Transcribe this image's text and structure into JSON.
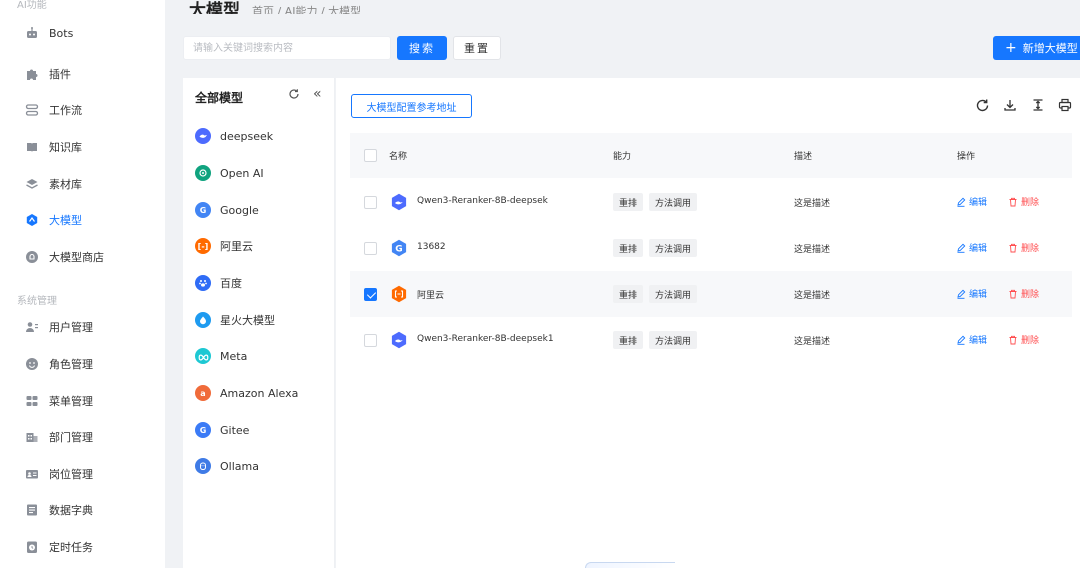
{
  "sidebar": {
    "group_ai": "AI功能",
    "group_system": "系统管理",
    "items": [
      {
        "label": "Bots",
        "icon": "robot-icon"
      },
      {
        "label": "插件",
        "icon": "puzzle-icon"
      },
      {
        "label": "工作流",
        "icon": "workflow-icon"
      },
      {
        "label": "知识库",
        "icon": "book-icon"
      },
      {
        "label": "素材库",
        "icon": "layers-icon"
      },
      {
        "label": "大模型",
        "icon": "model-icon",
        "active": true
      },
      {
        "label": "大模型商店",
        "icon": "store-icon"
      }
    ],
    "system_items": [
      {
        "label": "用户管理",
        "icon": "user-icon"
      },
      {
        "label": "角色管理",
        "icon": "role-icon"
      },
      {
        "label": "菜单管理",
        "icon": "menu-grid-icon"
      },
      {
        "label": "部门管理",
        "icon": "department-icon"
      },
      {
        "label": "岗位管理",
        "icon": "id-card-icon"
      },
      {
        "label": "数据字典",
        "icon": "dictionary-icon"
      },
      {
        "label": "定时任务",
        "icon": "clock-icon"
      }
    ]
  },
  "header": {
    "title": "大模型",
    "breadcrumb": "首页 / AI能力 / 大模型"
  },
  "toolbar": {
    "search_placeholder": "请输入关键词搜索内容",
    "search_label": "搜索",
    "reset_label": "重置",
    "add_label": "新增大模型"
  },
  "model_panel": {
    "title": "全部模型",
    "models": [
      {
        "label": "deepseek",
        "color": "#4d6bfe"
      },
      {
        "label": "Open AI",
        "color": "#10a37f"
      },
      {
        "label": "Google",
        "color": "#4285f4"
      },
      {
        "label": "阿里云",
        "color": "#ff6a00"
      },
      {
        "label": "百度",
        "color": "#2f6cf6"
      },
      {
        "label": "星火大模型",
        "color": "#1e9bf0"
      },
      {
        "label": "Meta",
        "color": "#1ec8d3"
      },
      {
        "label": "Amazon Alexa",
        "color": "#f06b3a"
      },
      {
        "label": "Gitee",
        "color": "#3b7bf6"
      },
      {
        "label": "Ollama",
        "color": "#3f7be6"
      }
    ]
  },
  "main": {
    "ref_button": "大模型配置参考地址",
    "columns": {
      "name": "名称",
      "ability": "能力",
      "desc": "描述",
      "action": "操作"
    },
    "actions": {
      "edit": "编辑",
      "delete": "删除"
    },
    "rows": [
      {
        "name": "Qwen3-Reranker-8B-deepsek",
        "tag1": "重排",
        "tag2": "方法调用",
        "desc": "这是描述",
        "checked": false,
        "icon": "deepseek"
      },
      {
        "name": "13682",
        "tag1": "重排",
        "tag2": "方法调用",
        "desc": "这是描述",
        "checked": false,
        "icon": "google"
      },
      {
        "name": "阿里云",
        "tag1": "重排",
        "tag2": "方法调用",
        "desc": "这是描述",
        "checked": true,
        "icon": "aliyun"
      },
      {
        "name": "Qwen3-Reranker-8B-deepsek1",
        "tag1": "重排",
        "tag2": "方法调用",
        "desc": "这是描述",
        "checked": false,
        "icon": "deepseek"
      }
    ]
  }
}
